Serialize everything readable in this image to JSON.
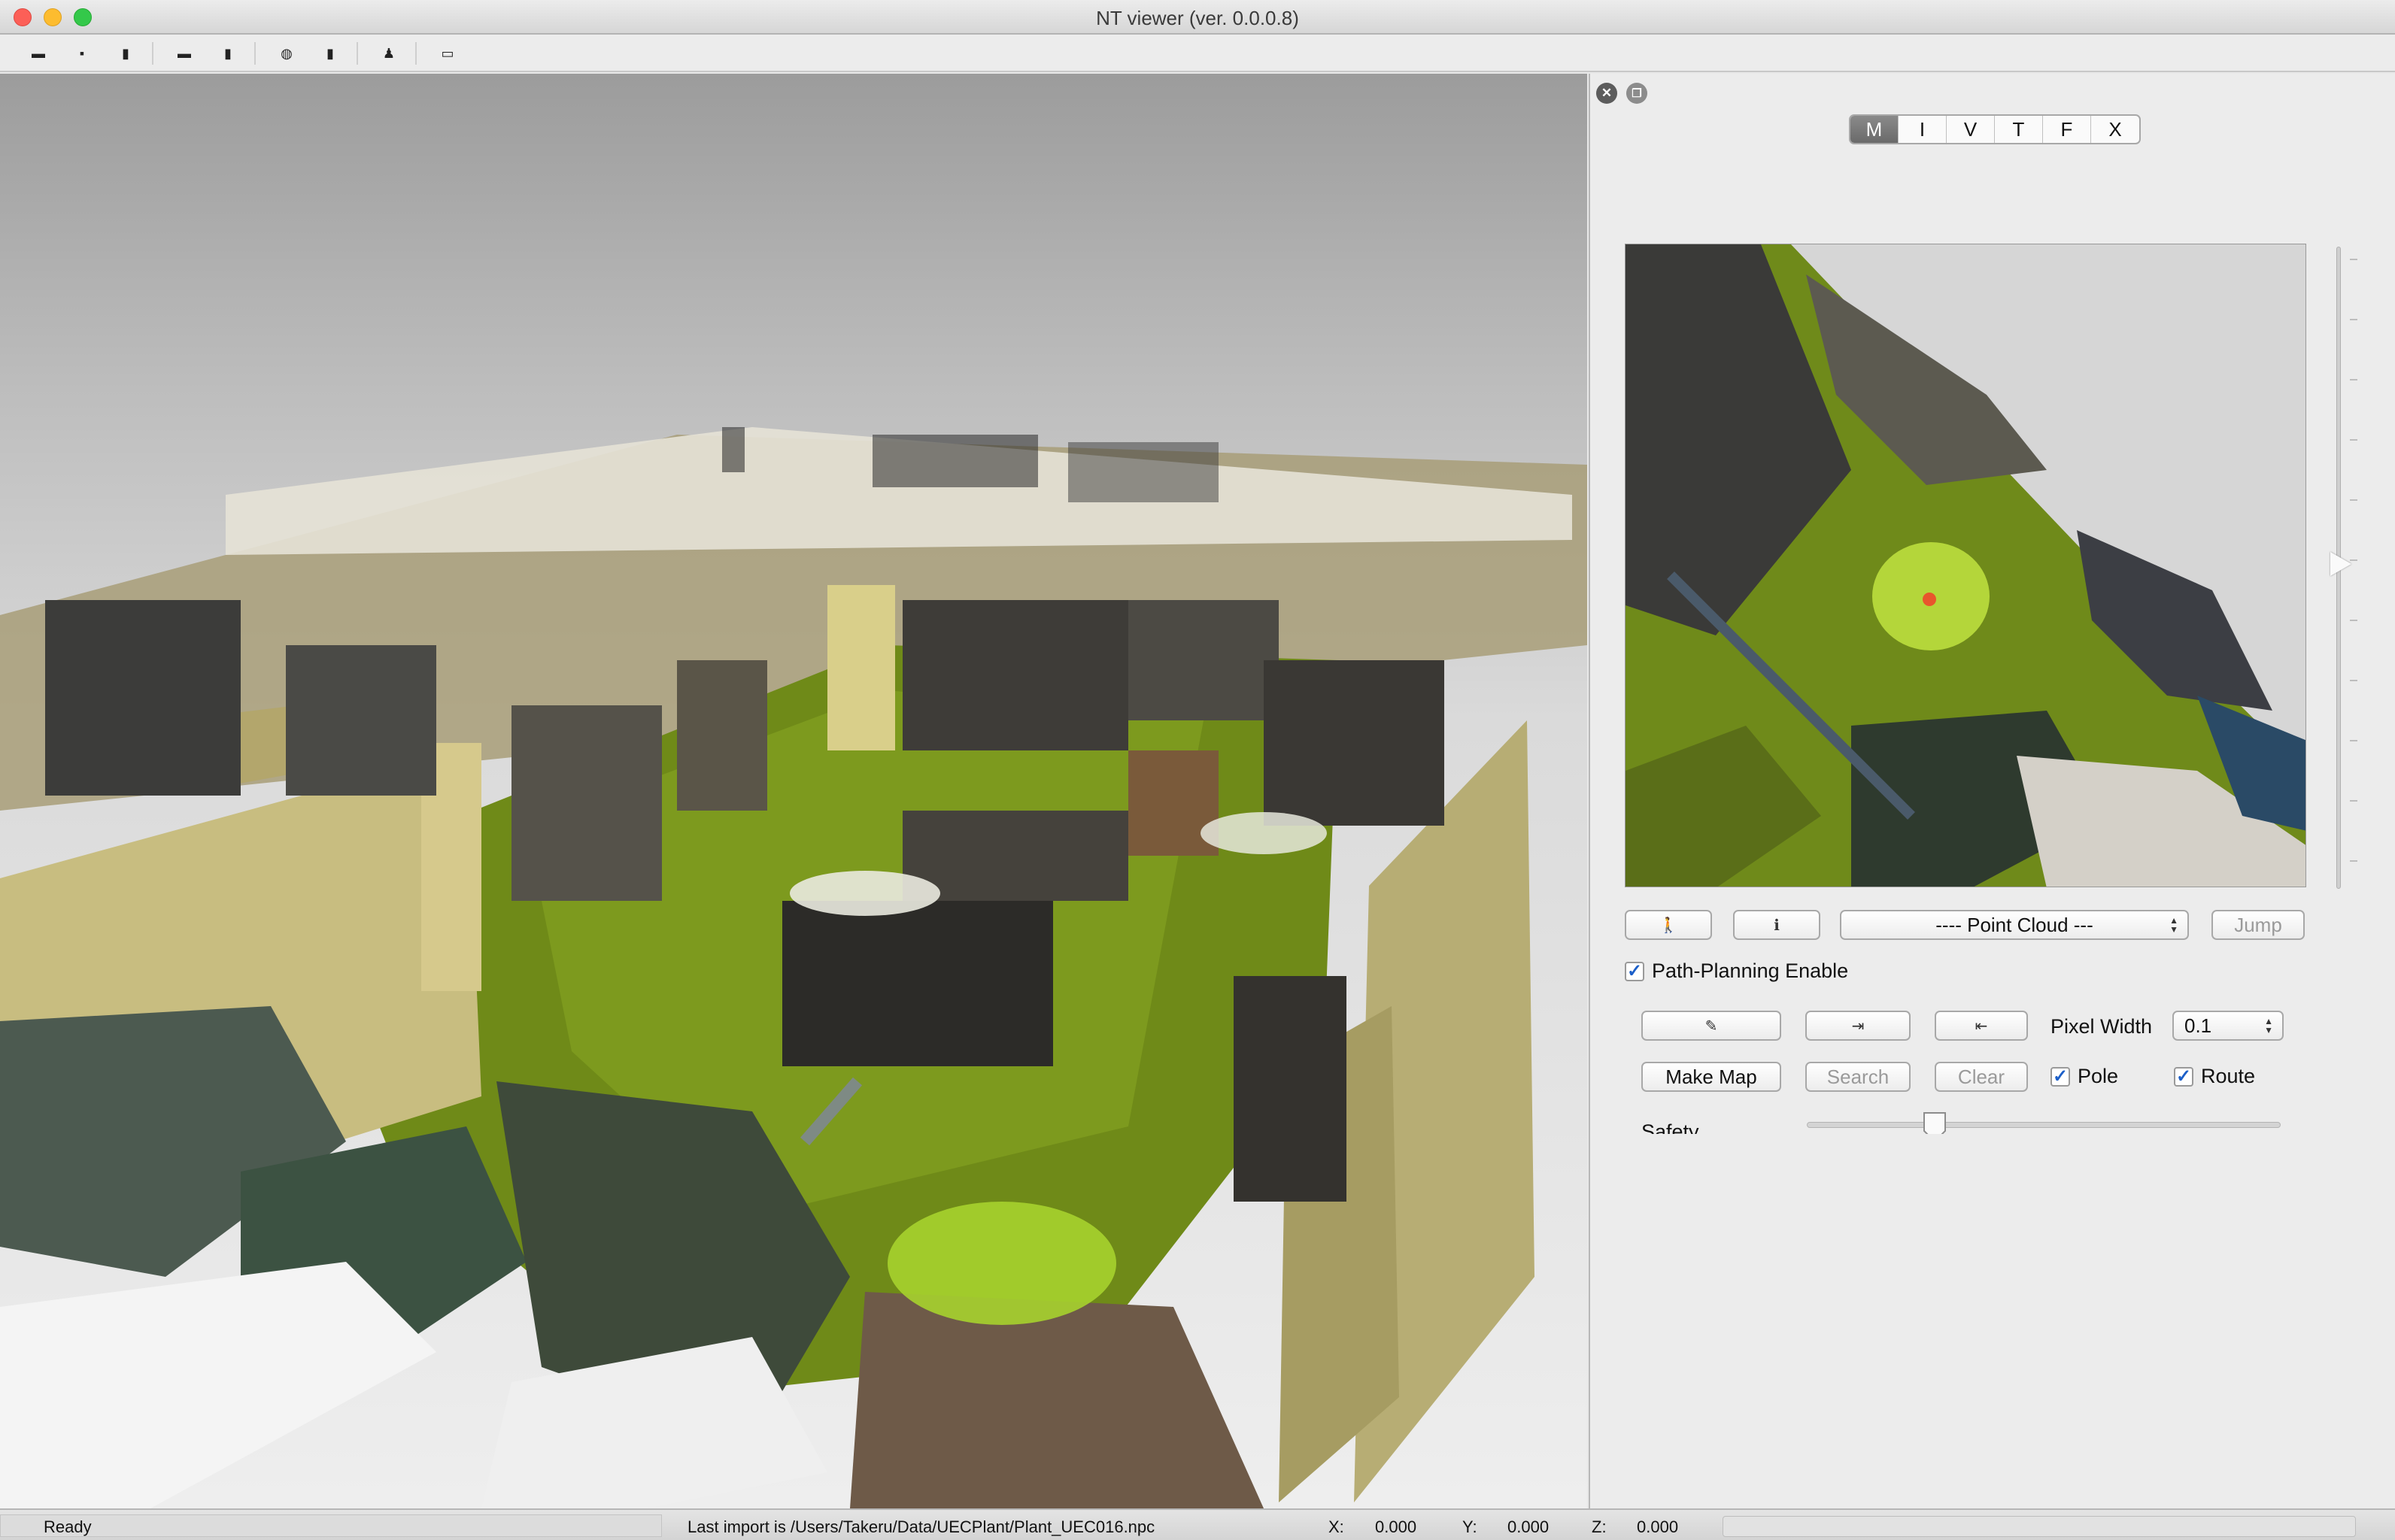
{
  "window": {
    "title": "NT viewer (ver. 0.0.0.8)"
  },
  "toolbar": {
    "items": [
      {
        "icon": "open-file-icon",
        "glyph": "▬"
      },
      {
        "icon": "save-icon",
        "glyph": "▪"
      },
      {
        "icon": "trash-icon",
        "glyph": "▮"
      },
      {
        "icon": "import-icon",
        "glyph": "▬"
      },
      {
        "icon": "delete-icon",
        "glyph": "▮"
      },
      {
        "icon": "globe-icon",
        "glyph": "◍"
      },
      {
        "icon": "remove-icon",
        "glyph": "▮"
      },
      {
        "icon": "person-icon",
        "glyph": "♟"
      },
      {
        "icon": "image-icon",
        "glyph": "▭"
      }
    ]
  },
  "panel": {
    "close_glyph": "✕",
    "float_glyph": "❐",
    "tabs": [
      {
        "label": "M",
        "active": true
      },
      {
        "label": "I",
        "active": false
      },
      {
        "label": "V",
        "active": false
      },
      {
        "label": "T",
        "active": false
      },
      {
        "label": "F",
        "active": false
      },
      {
        "label": "X",
        "active": false
      }
    ],
    "walk_glyph": "🚶",
    "info_glyph": "ℹ",
    "layer_select": {
      "value": "---- Point Cloud ---"
    },
    "jump_label": "Jump",
    "path_planning": {
      "label": "Path-Planning Enable",
      "checked": true
    },
    "pen_glyph": "✎",
    "import_glyph": "⇥",
    "export_glyph": "⇤",
    "pixel_width": {
      "label": "Pixel Width",
      "value": "0.1"
    },
    "make_map_label": "Make Map",
    "search_label": "Search",
    "clear_label": "Clear",
    "pole": {
      "label": "Pole",
      "checked": true
    },
    "route": {
      "label": "Route",
      "checked": true
    },
    "safety": {
      "label": "Safety",
      "value_fraction": 0.27
    },
    "check_glyph": "✓"
  },
  "status": {
    "ready": "Ready",
    "message": "Last import is /Users/Takeru/Data/UECPlant/Plant_UEC016.npc",
    "x_label": "X:",
    "x_value": "0.000",
    "y_label": "Y:",
    "y_value": "0.000",
    "z_label": "Z:",
    "z_value": "0.000"
  }
}
